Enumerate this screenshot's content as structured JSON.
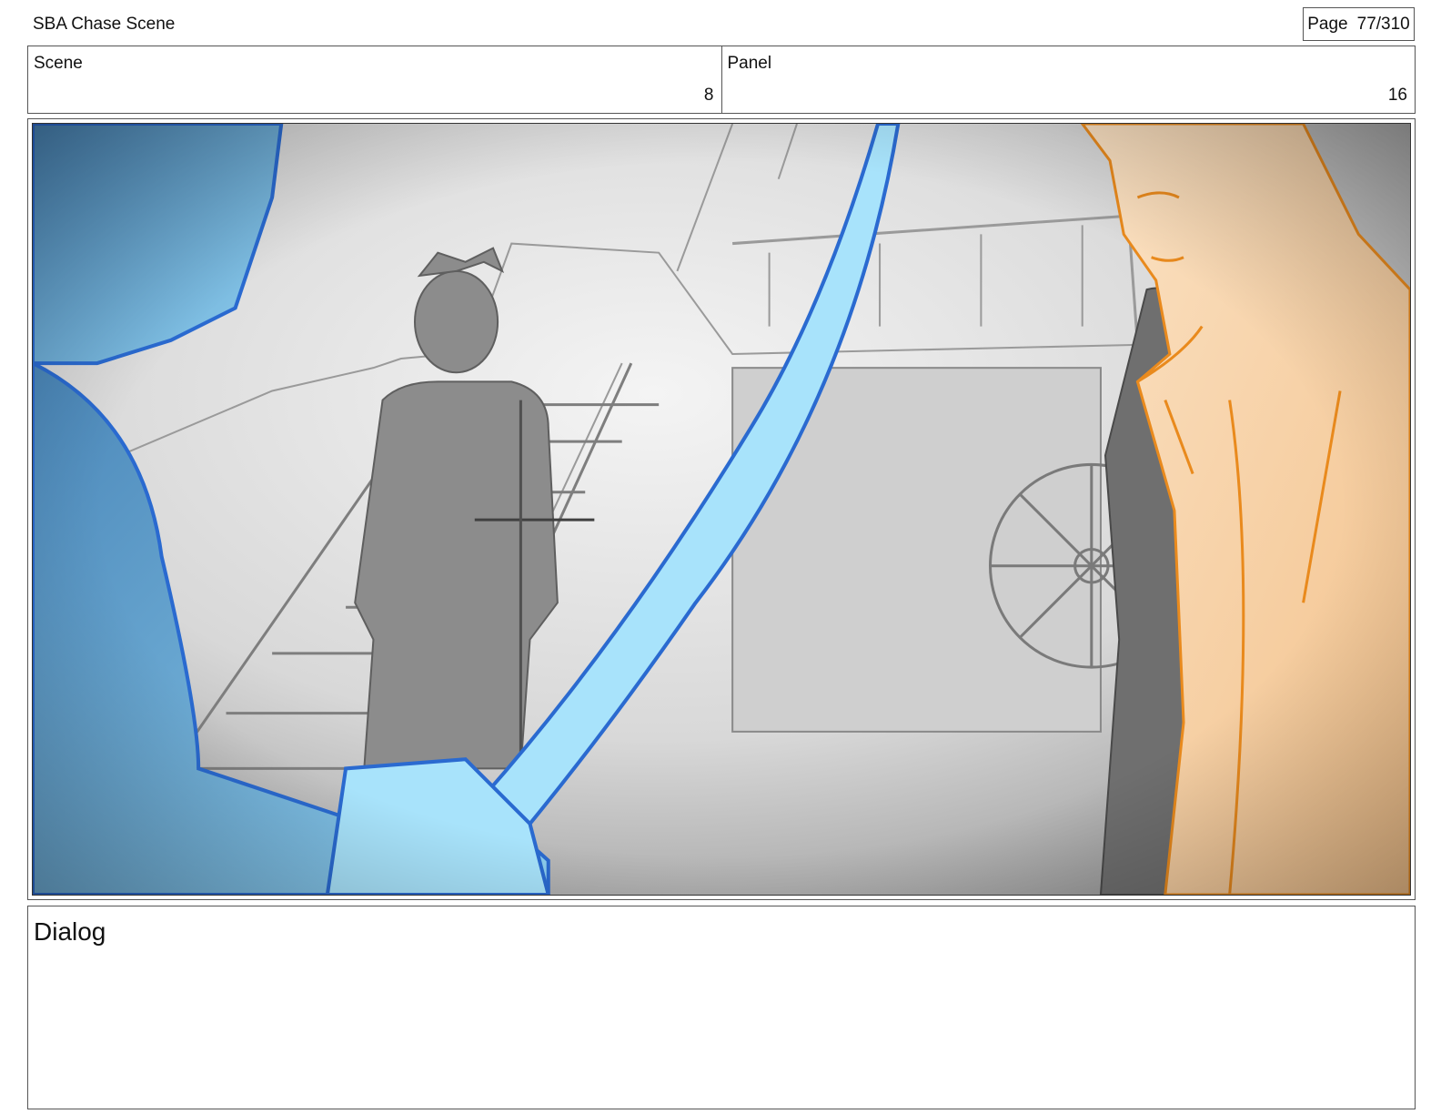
{
  "header": {
    "project_title": "SBA Chase Scene",
    "page_label": "Page",
    "page_value": "77/310"
  },
  "info": {
    "scene_label": "Scene",
    "scene_value": "8",
    "panel_label": "Panel",
    "panel_value": "16"
  },
  "panel": {
    "image": "storyboard-sketch",
    "colors": {
      "foreground_blue": "#7fd3f5",
      "foreground_orange": "#f6c48f",
      "sketch_grey": "#8a8a8a"
    }
  },
  "dialog": {
    "label": "Dialog",
    "text": ""
  }
}
